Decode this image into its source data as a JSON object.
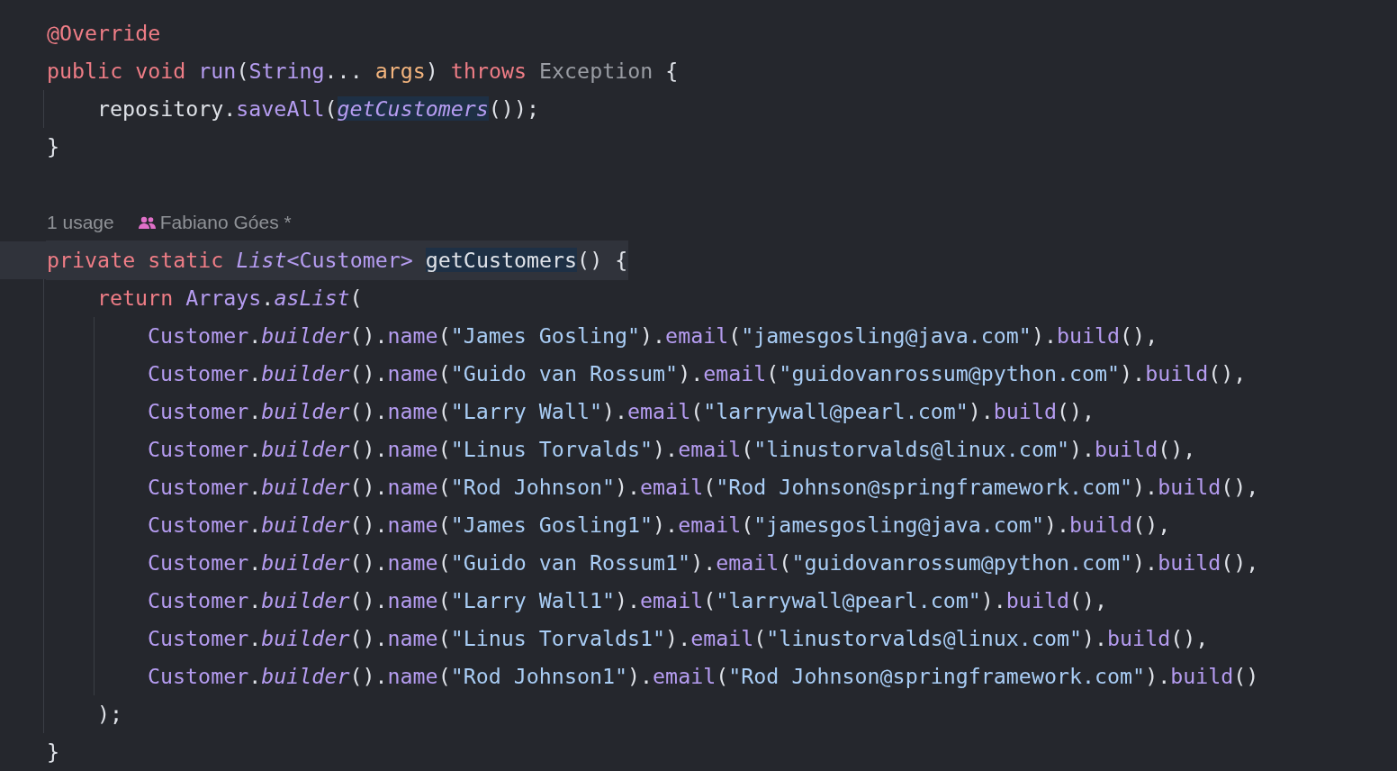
{
  "editor": {
    "lines": [
      {
        "kind": "code",
        "current": false,
        "tokens": [
          {
            "text": "@Override",
            "kind": "kw",
            "highlighted": false
          }
        ]
      },
      {
        "kind": "code",
        "current": false,
        "tokens": [
          {
            "text": "public void ",
            "kind": "kw",
            "highlighted": false
          },
          {
            "text": "run",
            "kind": "fn",
            "highlighted": false
          },
          {
            "text": "(",
            "kind": "plain",
            "highlighted": false
          },
          {
            "text": "String",
            "kind": "type",
            "highlighted": false
          },
          {
            "text": "... ",
            "kind": "plain",
            "highlighted": false
          },
          {
            "text": "args",
            "kind": "param",
            "highlighted": false
          },
          {
            "text": ") ",
            "kind": "plain",
            "highlighted": false
          },
          {
            "text": "throws ",
            "kind": "kw",
            "highlighted": false
          },
          {
            "text": "Exception",
            "kind": "muted",
            "highlighted": false
          },
          {
            "text": " {",
            "kind": "plain",
            "highlighted": false
          }
        ],
        "children": [
          {
            "kind": "code",
            "current": false,
            "tokens": [
              {
                "text": "repository.",
                "kind": "plain",
                "highlighted": false
              },
              {
                "text": "saveAll",
                "kind": "fn",
                "highlighted": false
              },
              {
                "text": "(",
                "kind": "plain",
                "highlighted": false
              },
              {
                "text": "getCustomers",
                "kind": "fni",
                "highlighted": true
              },
              {
                "text": "());",
                "kind": "plain",
                "highlighted": false
              }
            ]
          }
        ]
      },
      {
        "kind": "code",
        "current": false,
        "tokens": [
          {
            "text": "}",
            "kind": "plain",
            "highlighted": false
          }
        ]
      },
      {
        "kind": "blank"
      },
      {
        "kind": "usage",
        "usages": "1 usage",
        "author": "Fabiano Góes *"
      },
      {
        "kind": "code",
        "current": true,
        "tokens": [
          {
            "text": "private static ",
            "kind": "kw",
            "highlighted": false
          },
          {
            "text": "List",
            "kind": "typei",
            "highlighted": false
          },
          {
            "text": "<Customer> ",
            "kind": "type",
            "highlighted": false
          },
          {
            "text": "getCustomers",
            "kind": "plain",
            "highlighted": true
          },
          {
            "text": "() {",
            "kind": "plain",
            "highlighted": false
          }
        ],
        "children": [
          {
            "kind": "code",
            "current": false,
            "tokens": [
              {
                "text": "return ",
                "kind": "kw",
                "highlighted": false
              },
              {
                "text": "Arrays",
                "kind": "type",
                "highlighted": false
              },
              {
                "text": ".",
                "kind": "plain",
                "highlighted": false
              },
              {
                "text": "asList",
                "kind": "fni",
                "highlighted": false
              },
              {
                "text": "(",
                "kind": "plain",
                "highlighted": false
              }
            ],
            "children": [
              {
                "kind": "code",
                "current": false,
                "tokens": [
                  {
                    "text": "Customer",
                    "kind": "type",
                    "highlighted": false
                  },
                  {
                    "text": ".",
                    "kind": "plain",
                    "highlighted": false
                  },
                  {
                    "text": "builder",
                    "kind": "fni",
                    "highlighted": false
                  },
                  {
                    "text": "().",
                    "kind": "plain",
                    "highlighted": false
                  },
                  {
                    "text": "name",
                    "kind": "fn",
                    "highlighted": false
                  },
                  {
                    "text": "(",
                    "kind": "plain",
                    "highlighted": false
                  },
                  {
                    "text": "\"James Gosling\"",
                    "kind": "str",
                    "highlighted": false
                  },
                  {
                    "text": ").",
                    "kind": "plain",
                    "highlighted": false
                  },
                  {
                    "text": "email",
                    "kind": "fn",
                    "highlighted": false
                  },
                  {
                    "text": "(",
                    "kind": "plain",
                    "highlighted": false
                  },
                  {
                    "text": "\"jamesgosling@java.com\"",
                    "kind": "str",
                    "highlighted": false
                  },
                  {
                    "text": ").",
                    "kind": "plain",
                    "highlighted": false
                  },
                  {
                    "text": "build",
                    "kind": "fn",
                    "highlighted": false
                  },
                  {
                    "text": "(),",
                    "kind": "plain",
                    "highlighted": false
                  }
                ]
              },
              {
                "kind": "code",
                "current": false,
                "tokens": [
                  {
                    "text": "Customer",
                    "kind": "type",
                    "highlighted": false
                  },
                  {
                    "text": ".",
                    "kind": "plain",
                    "highlighted": false
                  },
                  {
                    "text": "builder",
                    "kind": "fni",
                    "highlighted": false
                  },
                  {
                    "text": "().",
                    "kind": "plain",
                    "highlighted": false
                  },
                  {
                    "text": "name",
                    "kind": "fn",
                    "highlighted": false
                  },
                  {
                    "text": "(",
                    "kind": "plain",
                    "highlighted": false
                  },
                  {
                    "text": "\"Guido van Rossum\"",
                    "kind": "str",
                    "highlighted": false
                  },
                  {
                    "text": ").",
                    "kind": "plain",
                    "highlighted": false
                  },
                  {
                    "text": "email",
                    "kind": "fn",
                    "highlighted": false
                  },
                  {
                    "text": "(",
                    "kind": "plain",
                    "highlighted": false
                  },
                  {
                    "text": "\"guidovanrossum@python.com\"",
                    "kind": "str",
                    "highlighted": false
                  },
                  {
                    "text": ").",
                    "kind": "plain",
                    "highlighted": false
                  },
                  {
                    "text": "build",
                    "kind": "fn",
                    "highlighted": false
                  },
                  {
                    "text": "(),",
                    "kind": "plain",
                    "highlighted": false
                  }
                ]
              },
              {
                "kind": "code",
                "current": false,
                "tokens": [
                  {
                    "text": "Customer",
                    "kind": "type",
                    "highlighted": false
                  },
                  {
                    "text": ".",
                    "kind": "plain",
                    "highlighted": false
                  },
                  {
                    "text": "builder",
                    "kind": "fni",
                    "highlighted": false
                  },
                  {
                    "text": "().",
                    "kind": "plain",
                    "highlighted": false
                  },
                  {
                    "text": "name",
                    "kind": "fn",
                    "highlighted": false
                  },
                  {
                    "text": "(",
                    "kind": "plain",
                    "highlighted": false
                  },
                  {
                    "text": "\"Larry Wall\"",
                    "kind": "str",
                    "highlighted": false
                  },
                  {
                    "text": ").",
                    "kind": "plain",
                    "highlighted": false
                  },
                  {
                    "text": "email",
                    "kind": "fn",
                    "highlighted": false
                  },
                  {
                    "text": "(",
                    "kind": "plain",
                    "highlighted": false
                  },
                  {
                    "text": "\"larrywall@pearl.com\"",
                    "kind": "str",
                    "highlighted": false
                  },
                  {
                    "text": ").",
                    "kind": "plain",
                    "highlighted": false
                  },
                  {
                    "text": "build",
                    "kind": "fn",
                    "highlighted": false
                  },
                  {
                    "text": "(),",
                    "kind": "plain",
                    "highlighted": false
                  }
                ]
              },
              {
                "kind": "code",
                "current": false,
                "tokens": [
                  {
                    "text": "Customer",
                    "kind": "type",
                    "highlighted": false
                  },
                  {
                    "text": ".",
                    "kind": "plain",
                    "highlighted": false
                  },
                  {
                    "text": "builder",
                    "kind": "fni",
                    "highlighted": false
                  },
                  {
                    "text": "().",
                    "kind": "plain",
                    "highlighted": false
                  },
                  {
                    "text": "name",
                    "kind": "fn",
                    "highlighted": false
                  },
                  {
                    "text": "(",
                    "kind": "plain",
                    "highlighted": false
                  },
                  {
                    "text": "\"Linus Torvalds\"",
                    "kind": "str",
                    "highlighted": false
                  },
                  {
                    "text": ").",
                    "kind": "plain",
                    "highlighted": false
                  },
                  {
                    "text": "email",
                    "kind": "fn",
                    "highlighted": false
                  },
                  {
                    "text": "(",
                    "kind": "plain",
                    "highlighted": false
                  },
                  {
                    "text": "\"linustorvalds@linux.com\"",
                    "kind": "str",
                    "highlighted": false
                  },
                  {
                    "text": ").",
                    "kind": "plain",
                    "highlighted": false
                  },
                  {
                    "text": "build",
                    "kind": "fn",
                    "highlighted": false
                  },
                  {
                    "text": "(),",
                    "kind": "plain",
                    "highlighted": false
                  }
                ]
              },
              {
                "kind": "code",
                "current": false,
                "tokens": [
                  {
                    "text": "Customer",
                    "kind": "type",
                    "highlighted": false
                  },
                  {
                    "text": ".",
                    "kind": "plain",
                    "highlighted": false
                  },
                  {
                    "text": "builder",
                    "kind": "fni",
                    "highlighted": false
                  },
                  {
                    "text": "().",
                    "kind": "plain",
                    "highlighted": false
                  },
                  {
                    "text": "name",
                    "kind": "fn",
                    "highlighted": false
                  },
                  {
                    "text": "(",
                    "kind": "plain",
                    "highlighted": false
                  },
                  {
                    "text": "\"Rod Johnson\"",
                    "kind": "str",
                    "highlighted": false
                  },
                  {
                    "text": ").",
                    "kind": "plain",
                    "highlighted": false
                  },
                  {
                    "text": "email",
                    "kind": "fn",
                    "highlighted": false
                  },
                  {
                    "text": "(",
                    "kind": "plain",
                    "highlighted": false
                  },
                  {
                    "text": "\"Rod Johnson@springframework.com\"",
                    "kind": "str",
                    "highlighted": false
                  },
                  {
                    "text": ").",
                    "kind": "plain",
                    "highlighted": false
                  },
                  {
                    "text": "build",
                    "kind": "fn",
                    "highlighted": false
                  },
                  {
                    "text": "(),",
                    "kind": "plain",
                    "highlighted": false
                  }
                ]
              },
              {
                "kind": "code",
                "current": false,
                "tokens": [
                  {
                    "text": "Customer",
                    "kind": "type",
                    "highlighted": false
                  },
                  {
                    "text": ".",
                    "kind": "plain",
                    "highlighted": false
                  },
                  {
                    "text": "builder",
                    "kind": "fni",
                    "highlighted": false
                  },
                  {
                    "text": "().",
                    "kind": "plain",
                    "highlighted": false
                  },
                  {
                    "text": "name",
                    "kind": "fn",
                    "highlighted": false
                  },
                  {
                    "text": "(",
                    "kind": "plain",
                    "highlighted": false
                  },
                  {
                    "text": "\"James Gosling1\"",
                    "kind": "str",
                    "highlighted": false
                  },
                  {
                    "text": ").",
                    "kind": "plain",
                    "highlighted": false
                  },
                  {
                    "text": "email",
                    "kind": "fn",
                    "highlighted": false
                  },
                  {
                    "text": "(",
                    "kind": "plain",
                    "highlighted": false
                  },
                  {
                    "text": "\"jamesgosling@java.com\"",
                    "kind": "str",
                    "highlighted": false
                  },
                  {
                    "text": ").",
                    "kind": "plain",
                    "highlighted": false
                  },
                  {
                    "text": "build",
                    "kind": "fn",
                    "highlighted": false
                  },
                  {
                    "text": "(),",
                    "kind": "plain",
                    "highlighted": false
                  }
                ]
              },
              {
                "kind": "code",
                "current": false,
                "tokens": [
                  {
                    "text": "Customer",
                    "kind": "type",
                    "highlighted": false
                  },
                  {
                    "text": ".",
                    "kind": "plain",
                    "highlighted": false
                  },
                  {
                    "text": "builder",
                    "kind": "fni",
                    "highlighted": false
                  },
                  {
                    "text": "().",
                    "kind": "plain",
                    "highlighted": false
                  },
                  {
                    "text": "name",
                    "kind": "fn",
                    "highlighted": false
                  },
                  {
                    "text": "(",
                    "kind": "plain",
                    "highlighted": false
                  },
                  {
                    "text": "\"Guido van Rossum1\"",
                    "kind": "str",
                    "highlighted": false
                  },
                  {
                    "text": ").",
                    "kind": "plain",
                    "highlighted": false
                  },
                  {
                    "text": "email",
                    "kind": "fn",
                    "highlighted": false
                  },
                  {
                    "text": "(",
                    "kind": "plain",
                    "highlighted": false
                  },
                  {
                    "text": "\"guidovanrossum@python.com\"",
                    "kind": "str",
                    "highlighted": false
                  },
                  {
                    "text": ").",
                    "kind": "plain",
                    "highlighted": false
                  },
                  {
                    "text": "build",
                    "kind": "fn",
                    "highlighted": false
                  },
                  {
                    "text": "(),",
                    "kind": "plain",
                    "highlighted": false
                  }
                ]
              },
              {
                "kind": "code",
                "current": false,
                "tokens": [
                  {
                    "text": "Customer",
                    "kind": "type",
                    "highlighted": false
                  },
                  {
                    "text": ".",
                    "kind": "plain",
                    "highlighted": false
                  },
                  {
                    "text": "builder",
                    "kind": "fni",
                    "highlighted": false
                  },
                  {
                    "text": "().",
                    "kind": "plain",
                    "highlighted": false
                  },
                  {
                    "text": "name",
                    "kind": "fn",
                    "highlighted": false
                  },
                  {
                    "text": "(",
                    "kind": "plain",
                    "highlighted": false
                  },
                  {
                    "text": "\"Larry Wall1\"",
                    "kind": "str",
                    "highlighted": false
                  },
                  {
                    "text": ").",
                    "kind": "plain",
                    "highlighted": false
                  },
                  {
                    "text": "email",
                    "kind": "fn",
                    "highlighted": false
                  },
                  {
                    "text": "(",
                    "kind": "plain",
                    "highlighted": false
                  },
                  {
                    "text": "\"larrywall@pearl.com\"",
                    "kind": "str",
                    "highlighted": false
                  },
                  {
                    "text": ").",
                    "kind": "plain",
                    "highlighted": false
                  },
                  {
                    "text": "build",
                    "kind": "fn",
                    "highlighted": false
                  },
                  {
                    "text": "(),",
                    "kind": "plain",
                    "highlighted": false
                  }
                ]
              },
              {
                "kind": "code",
                "current": false,
                "tokens": [
                  {
                    "text": "Customer",
                    "kind": "type",
                    "highlighted": false
                  },
                  {
                    "text": ".",
                    "kind": "plain",
                    "highlighted": false
                  },
                  {
                    "text": "builder",
                    "kind": "fni",
                    "highlighted": false
                  },
                  {
                    "text": "().",
                    "kind": "plain",
                    "highlighted": false
                  },
                  {
                    "text": "name",
                    "kind": "fn",
                    "highlighted": false
                  },
                  {
                    "text": "(",
                    "kind": "plain",
                    "highlighted": false
                  },
                  {
                    "text": "\"Linus Torvalds1\"",
                    "kind": "str",
                    "highlighted": false
                  },
                  {
                    "text": ").",
                    "kind": "plain",
                    "highlighted": false
                  },
                  {
                    "text": "email",
                    "kind": "fn",
                    "highlighted": false
                  },
                  {
                    "text": "(",
                    "kind": "plain",
                    "highlighted": false
                  },
                  {
                    "text": "\"linustorvalds@linux.com\"",
                    "kind": "str",
                    "highlighted": false
                  },
                  {
                    "text": ").",
                    "kind": "plain",
                    "highlighted": false
                  },
                  {
                    "text": "build",
                    "kind": "fn",
                    "highlighted": false
                  },
                  {
                    "text": "(),",
                    "kind": "plain",
                    "highlighted": false
                  }
                ]
              },
              {
                "kind": "code",
                "current": false,
                "tokens": [
                  {
                    "text": "Customer",
                    "kind": "type",
                    "highlighted": false
                  },
                  {
                    "text": ".",
                    "kind": "plain",
                    "highlighted": false
                  },
                  {
                    "text": "builder",
                    "kind": "fni",
                    "highlighted": false
                  },
                  {
                    "text": "().",
                    "kind": "plain",
                    "highlighted": false
                  },
                  {
                    "text": "name",
                    "kind": "fn",
                    "highlighted": false
                  },
                  {
                    "text": "(",
                    "kind": "plain",
                    "highlighted": false
                  },
                  {
                    "text": "\"Rod Johnson1\"",
                    "kind": "str",
                    "highlighted": false
                  },
                  {
                    "text": ").",
                    "kind": "plain",
                    "highlighted": false
                  },
                  {
                    "text": "email",
                    "kind": "fn",
                    "highlighted": false
                  },
                  {
                    "text": "(",
                    "kind": "plain",
                    "highlighted": false
                  },
                  {
                    "text": "\"Rod Johnson@springframework.com\"",
                    "kind": "str",
                    "highlighted": false
                  },
                  {
                    "text": ").",
                    "kind": "plain",
                    "highlighted": false
                  },
                  {
                    "text": "build",
                    "kind": "fn",
                    "highlighted": false
                  },
                  {
                    "text": "()",
                    "kind": "plain",
                    "highlighted": false
                  }
                ]
              }
            ]
          },
          {
            "kind": "code",
            "current": false,
            "tokens": [
              {
                "text": ");",
                "kind": "plain",
                "highlighted": false
              }
            ]
          }
        ]
      },
      {
        "kind": "code",
        "current": false,
        "tokens": [
          {
            "text": "}",
            "kind": "plain",
            "highlighted": false
          }
        ]
      }
    ]
  }
}
